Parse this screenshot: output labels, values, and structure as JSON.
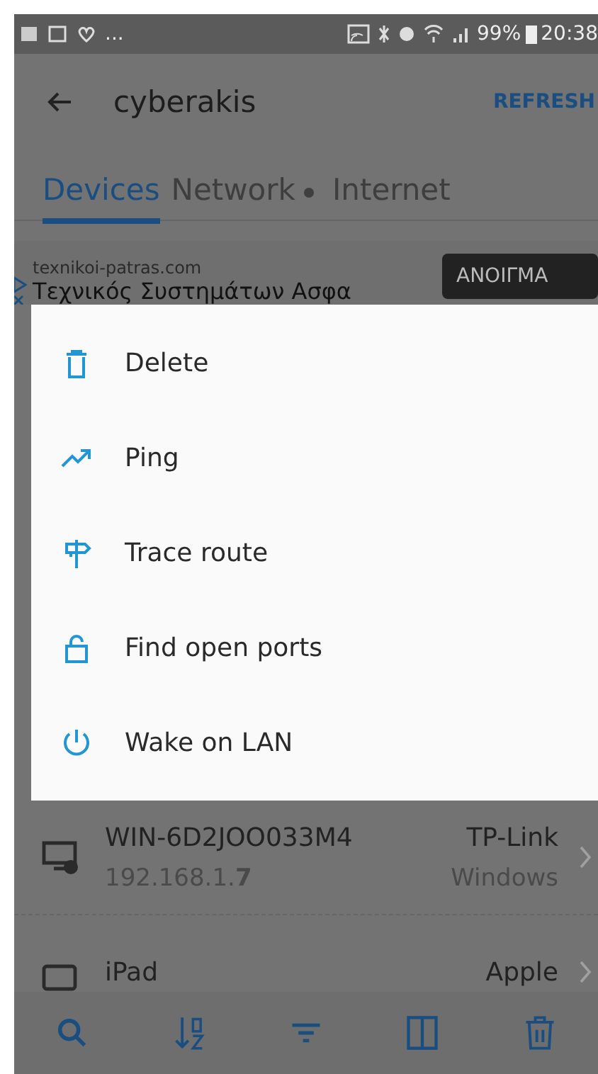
{
  "status_bar": {
    "overflow": "...",
    "battery": "99%",
    "time": "20:38"
  },
  "app_bar": {
    "title": "cyberakis",
    "action": "REFRESH"
  },
  "tabs": [
    {
      "label": "Devices",
      "selected": true,
      "dot": false
    },
    {
      "label": "Network",
      "selected": false,
      "dot": true
    },
    {
      "label": "Internet",
      "selected": false,
      "dot": false
    }
  ],
  "ad": {
    "domain": "texnikoi-patras.com",
    "headline": "Τεχνικός Συστημάτων Ασφα",
    "button": "ΑΝΟΙΓΜΑ"
  },
  "menu": [
    {
      "label": "Delete"
    },
    {
      "label": "Ping"
    },
    {
      "label": "Trace route"
    },
    {
      "label": "Find open ports"
    },
    {
      "label": "Wake on LAN"
    }
  ],
  "devices": [
    {
      "name": "WIN-6D2JOO033M4",
      "ip": "192.168.1.**7**",
      "vendor": "TP-Link",
      "os": "Windows",
      "kind": "computer"
    },
    {
      "name": "iPad",
      "vendor": "Apple",
      "kind": "tablet"
    }
  ]
}
